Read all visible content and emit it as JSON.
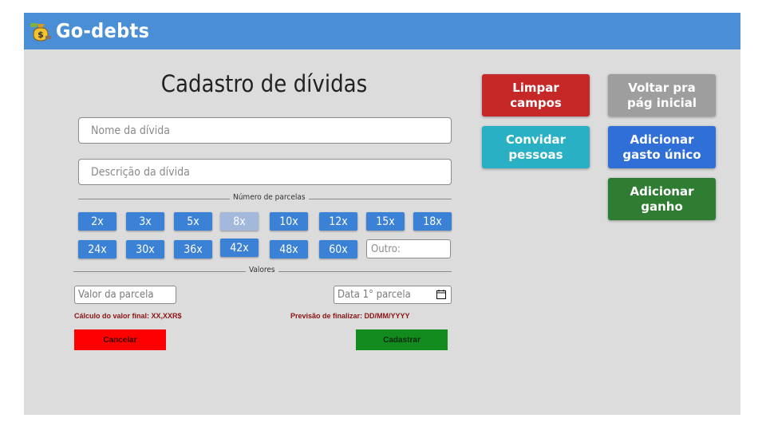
{
  "app": {
    "title": "Go-debts",
    "logo_icon": "money-bag-icon"
  },
  "page": {
    "title": "Cadastro de dívidas"
  },
  "form": {
    "nome_placeholder": "Nome da dívida",
    "descricao_placeholder": "Descrição da dívida",
    "parcelas_label": "Número de parcelas",
    "parcelas": [
      "2x",
      "3x",
      "5x",
      "8x",
      "10x",
      "12x",
      "15x",
      "18x",
      "24x",
      "30x",
      "36x",
      "42x",
      "48x",
      "60x"
    ],
    "parcela_selecionada": "8x",
    "outro_placeholder": "Outro:",
    "valores_label": "Valores",
    "valor_parcela_placeholder": "Valor da parcela",
    "data_parcela_placeholder": "Data 1° parcela",
    "calculo_valor_final": "Cálculo do valor final: XX,XXR$",
    "previsao_finalizar": "Previsão de finalizar: DD/MM/YYYY",
    "cancelar": "Cancelar",
    "cadastrar": "Cadastrar"
  },
  "actions": {
    "limpar_campos": "Limpar\ncampos",
    "voltar": "Voltar pra\npág inicial",
    "convidar": "Convidar\npessoas",
    "gasto_unico": "Adicionar\ngasto único",
    "ganho": "Adicionar\nganho"
  },
  "colors": {
    "header": "#4a8fd6",
    "background": "#dcdcdc",
    "limpar": "#c62828",
    "voltar": "#9e9e9e",
    "convidar": "#29b0c4",
    "gasto_unico": "#2f6fd6",
    "ganho": "#2e7d32",
    "parcela": "#3b82d6",
    "parcela_selected": "#a2b9dc"
  }
}
